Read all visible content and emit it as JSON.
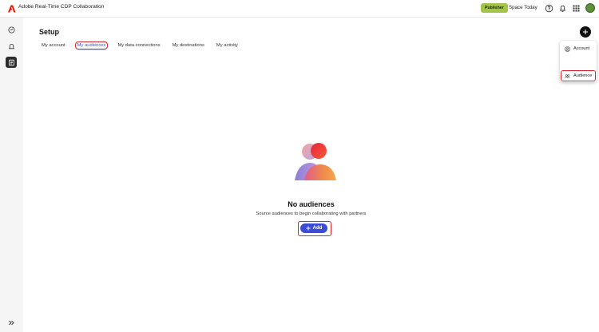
{
  "app": {
    "title": "Adobe Real-Time CDP Collaboration",
    "logo_icon": "adobe-logo-icon",
    "brand_color": "#eb1000"
  },
  "topbar": {
    "role_badge": "Publisher",
    "space_name": "Space Today",
    "icons": [
      "help-icon",
      "bell-icon",
      "apps-grid-icon",
      "user-avatar"
    ]
  },
  "leftrail": {
    "items": [
      {
        "icon": "overview-icon",
        "active": false
      },
      {
        "icon": "bell-outline-icon",
        "active": false
      },
      {
        "icon": "setup-icon",
        "active": true
      }
    ],
    "collapse_icon": "chevron-double-right-icon"
  },
  "main": {
    "page_title": "Setup",
    "tabs": [
      {
        "label": "My account",
        "selected": false
      },
      {
        "label": "My audiences",
        "selected": true
      },
      {
        "label": "My data connections",
        "selected": false
      },
      {
        "label": "My destinations",
        "selected": false
      },
      {
        "label": "My activity",
        "selected": false
      }
    ],
    "add_menu": {
      "items": [
        {
          "label": "Account",
          "icon": "account-icon"
        },
        {
          "label": "Audience",
          "icon": "audience-icon"
        }
      ]
    },
    "empty_state": {
      "title": "No audiences",
      "subtitle": "Source audiences to begin collaborating with partners",
      "add_label": "Add"
    }
  },
  "colors": {
    "accent": "#3b4cdb",
    "highlight": "#d8232a",
    "badge": "#a3c34a"
  }
}
